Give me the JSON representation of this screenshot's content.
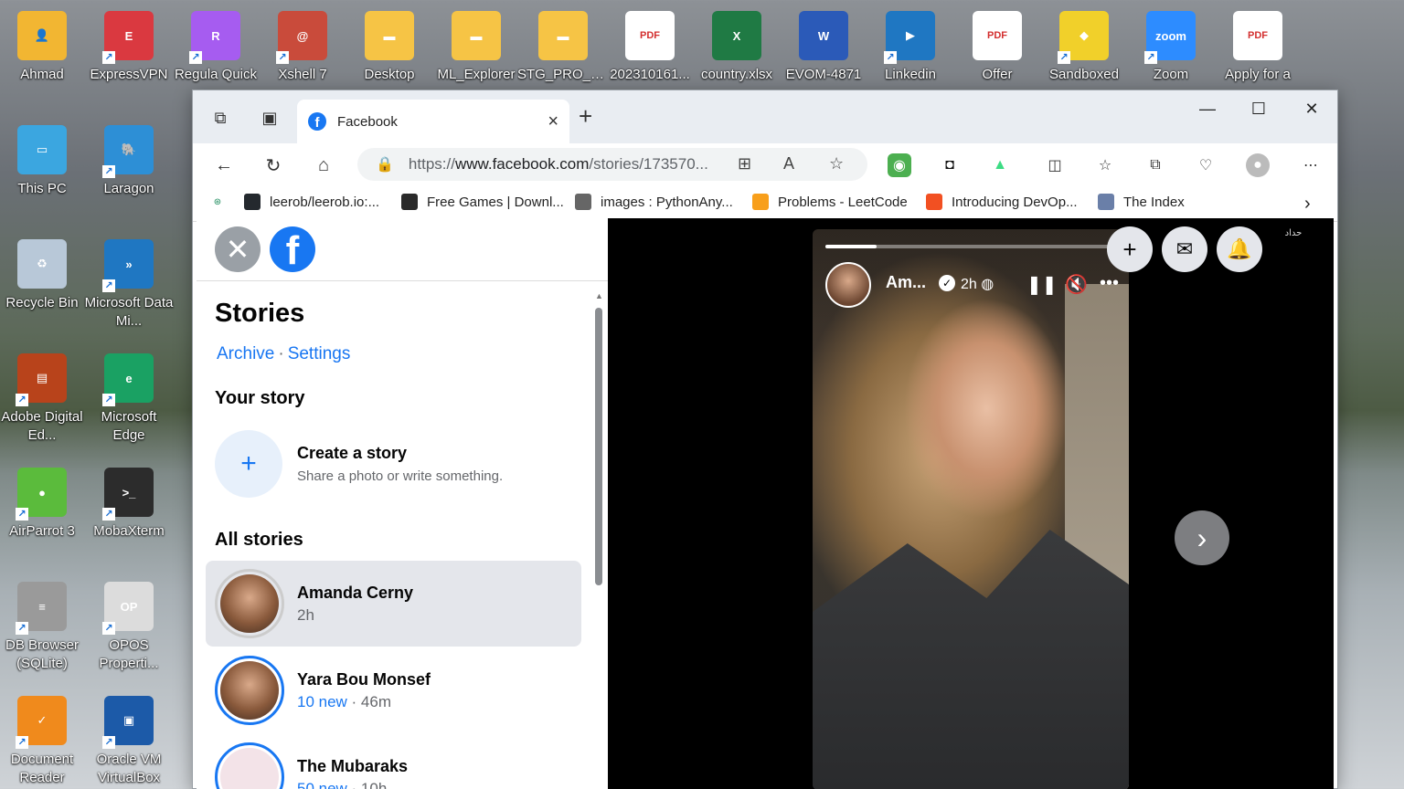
{
  "desktop": {
    "icons": [
      {
        "label": "Ahmad",
        "color": "#f2b632",
        "glyph": "👤"
      },
      {
        "label": "ExpressVPN",
        "color": "#da3940",
        "glyph": "E"
      },
      {
        "label": "Regula Quick",
        "color": "#a65cf0",
        "glyph": "R"
      },
      {
        "label": "Xshell 7",
        "color": "#c94b3b",
        "glyph": "@"
      },
      {
        "label": "Desktop",
        "color": "#f6c445",
        "glyph": "▬"
      },
      {
        "label": "ML_Explorer",
        "color": "#f6c445",
        "glyph": "▬"
      },
      {
        "label": "STG_PRO_P...",
        "color": "#f6c445",
        "glyph": "▬"
      },
      {
        "label": "202310161...",
        "color": "#ffffff",
        "glyph": "PDF"
      },
      {
        "label": "country.xlsx",
        "color": "#1f7a44",
        "glyph": "X"
      },
      {
        "label": "EVOM-4871",
        "color": "#2b5ab8",
        "glyph": "W"
      },
      {
        "label": "Linkedin",
        "color": "#1f77c2",
        "glyph": "▶"
      },
      {
        "label": "Offer",
        "color": "#ffffff",
        "glyph": "PDF"
      },
      {
        "label": "Sandboxed",
        "color": "#f1d02a",
        "glyph": "◆"
      },
      {
        "label": "Zoom",
        "color": "#2d8cff",
        "glyph": "zoom"
      },
      {
        "label": "Apply for a",
        "color": "#ffffff",
        "glyph": "PDF"
      },
      {
        "label": "This PC",
        "color": "#3ba6e0",
        "glyph": "▭"
      },
      {
        "label": "Laragon",
        "color": "#2d8fd6",
        "glyph": "🐘"
      },
      {
        "label": "Recycle Bin",
        "color": "#b8c8d8",
        "glyph": "♻"
      },
      {
        "label": "Microsoft Data Mi...",
        "color": "#1f77c2",
        "glyph": "»"
      },
      {
        "label": "Adobe Digital Ed...",
        "color": "#b8431b",
        "glyph": "▤"
      },
      {
        "label": "Microsoft Edge",
        "color": "#1aa163",
        "glyph": "e"
      },
      {
        "label": "AirParrot 3",
        "color": "#5bbb3c",
        "glyph": "●"
      },
      {
        "label": "MobaXterm",
        "color": "#2c2c2c",
        "glyph": ">_"
      },
      {
        "label": "DB Browser (SQLite)",
        "color": "#9a9a9a",
        "glyph": "≡"
      },
      {
        "label": "OPOS Properti...",
        "color": "#dcdcdc",
        "glyph": "OP"
      },
      {
        "label": "Document Reader",
        "color": "#f08a1c",
        "glyph": "✓"
      },
      {
        "label": "Oracle VM VirtualBox",
        "color": "#1c5aa8",
        "glyph": "▣"
      }
    ]
  },
  "browser": {
    "tab_title": "Facebook",
    "url_prefix": "https://",
    "url_domain": "www.facebook.com",
    "url_path": "/stories/173570...",
    "favorites": [
      {
        "label": "leerob/leerob.io:...",
        "icon": "github-icon",
        "color": "#24292e"
      },
      {
        "label": "Free Games | Downl...",
        "icon": "epic-icon",
        "color": "#2a2a2a"
      },
      {
        "label": "images : PythonAny...",
        "icon": "python-icon",
        "color": "#666666"
      },
      {
        "label": "Problems - LeetCode",
        "icon": "leetcode-icon",
        "color": "#f89f1b"
      },
      {
        "label": "Introducing DevOp...",
        "icon": "microsoft-icon",
        "color": "#f25022"
      },
      {
        "label": "The Index",
        "icon": "index-icon",
        "color": "#6a7fa8"
      }
    ]
  },
  "sidebar": {
    "title": "Stories",
    "archive": "Archive",
    "separator": "·",
    "settings": "Settings",
    "your_story": "Your story",
    "create_title": "Create a story",
    "create_sub": "Share a photo or write something.",
    "all_stories": "All stories",
    "stories": [
      {
        "name": "Amanda Cerny",
        "new": "",
        "time": "2h"
      },
      {
        "name": "Yara Bou Monsef",
        "new": "10 new",
        "time": " · 46m"
      },
      {
        "name": "The Mubaraks",
        "new": "50 new",
        "time": " · 10h"
      }
    ]
  },
  "viewer": {
    "author": "Am...",
    "time": "2h",
    "corner_text": "حداد"
  },
  "colors": {
    "fb_blue": "#1877f2",
    "active_bg": "#e4e6eb"
  }
}
